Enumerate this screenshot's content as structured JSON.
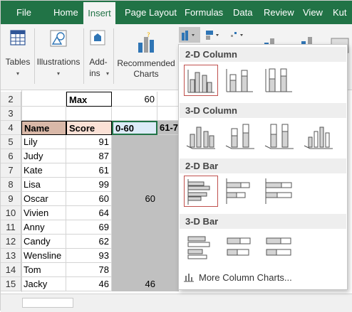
{
  "tabs": [
    "File",
    "Home",
    "Insert",
    "Page Layout",
    "Formulas",
    "Data",
    "Review",
    "View",
    "Kut"
  ],
  "ribbon": {
    "tables": "Tables",
    "illustrations": "Illustrations",
    "addins_line1": "Add-",
    "addins_line2": "ins",
    "recommended_line1": "Recommended",
    "recommended_line2": "Charts",
    "caret": "▾"
  },
  "rows": [
    {
      "num": "2",
      "a": "",
      "b": "Max",
      "c": "60",
      "d": ""
    },
    {
      "num": "3",
      "a": "",
      "b": "",
      "c": "",
      "d": ""
    },
    {
      "num": "4",
      "a": "Name",
      "b": "Score",
      "c": "0-60",
      "d": "61-7"
    },
    {
      "num": "5",
      "a": "Lily",
      "b": "91",
      "c": "",
      "d": ""
    },
    {
      "num": "6",
      "a": "Judy",
      "b": "87",
      "c": "",
      "d": ""
    },
    {
      "num": "7",
      "a": "Kate",
      "b": "61",
      "c": "",
      "d": ""
    },
    {
      "num": "8",
      "a": "Lisa",
      "b": "99",
      "c": "",
      "d": ""
    },
    {
      "num": "9",
      "a": "Oscar",
      "b": "60",
      "c": "60",
      "d": ""
    },
    {
      "num": "10",
      "a": "Vivien",
      "b": "64",
      "c": "",
      "d": ""
    },
    {
      "num": "11",
      "a": "Anny",
      "b": "69",
      "c": "",
      "d": ""
    },
    {
      "num": "12",
      "a": "Candy",
      "b": "62",
      "c": "",
      "d": ""
    },
    {
      "num": "13",
      "a": "Wensline",
      "b": "93",
      "c": "",
      "d": ""
    },
    {
      "num": "14",
      "a": "Tom",
      "b": "78",
      "c": "",
      "d": ""
    },
    {
      "num": "15",
      "a": "Jacky",
      "b": "46",
      "c": "46",
      "d": ""
    }
  ],
  "gallery": {
    "sections": [
      "2-D Column",
      "3-D Column",
      "2-D Bar",
      "3-D Bar"
    ],
    "more": "More Column Charts..."
  },
  "colors": {
    "excel_green": "#217346",
    "header_fill": "#d9b8a8",
    "range_gray": "#c0c0c0",
    "chart_bar": "#d4d4d4",
    "selection": "#c0504d"
  }
}
